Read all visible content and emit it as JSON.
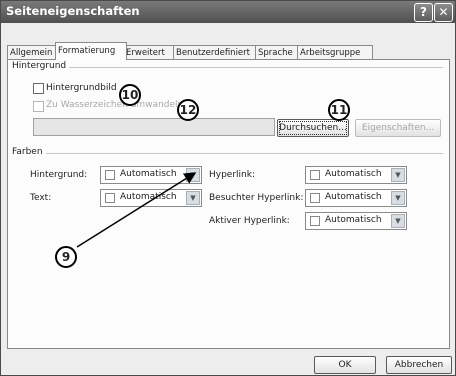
{
  "window": {
    "title": "Seiteneigenschaften",
    "help_button": "?",
    "close_button": "✕"
  },
  "tabs": [
    "Allgemein",
    "Formatierung",
    "Erweitert",
    "Benutzerdefiniert",
    "Sprache",
    "Arbeitsgruppe"
  ],
  "active_tab": "Formatierung",
  "background_group": {
    "label": "Hintergrund",
    "image_checkbox_label": "Hintergrundbild",
    "image_checked": false,
    "watermark_checkbox_label": "Zu Wasserzeichen umwandeln",
    "watermark_checked": false,
    "path_value": "",
    "browse_button": "Durchsuchen...",
    "properties_button": "Eigenschaften..."
  },
  "colors_group": {
    "label": "Farben",
    "background_label": "Hintergrund:",
    "background_value": "Automatisch",
    "text_label": "Text:",
    "text_value": "Automatisch",
    "hyperlink_label": "Hyperlink:",
    "hyperlink_value": "Automatisch",
    "visited_label": "Besuchter Hyperlink:",
    "visited_value": "Automatisch",
    "active_label": "Aktiver Hyperlink:",
    "active_value": "Automatisch"
  },
  "footer": {
    "ok_button": "OK",
    "cancel_button": "Abbrechen"
  },
  "callouts": {
    "c9": "9",
    "c10": "10",
    "c11": "11",
    "c12": "12"
  },
  "icons": {
    "dropdown": "chevron-down-icon"
  }
}
